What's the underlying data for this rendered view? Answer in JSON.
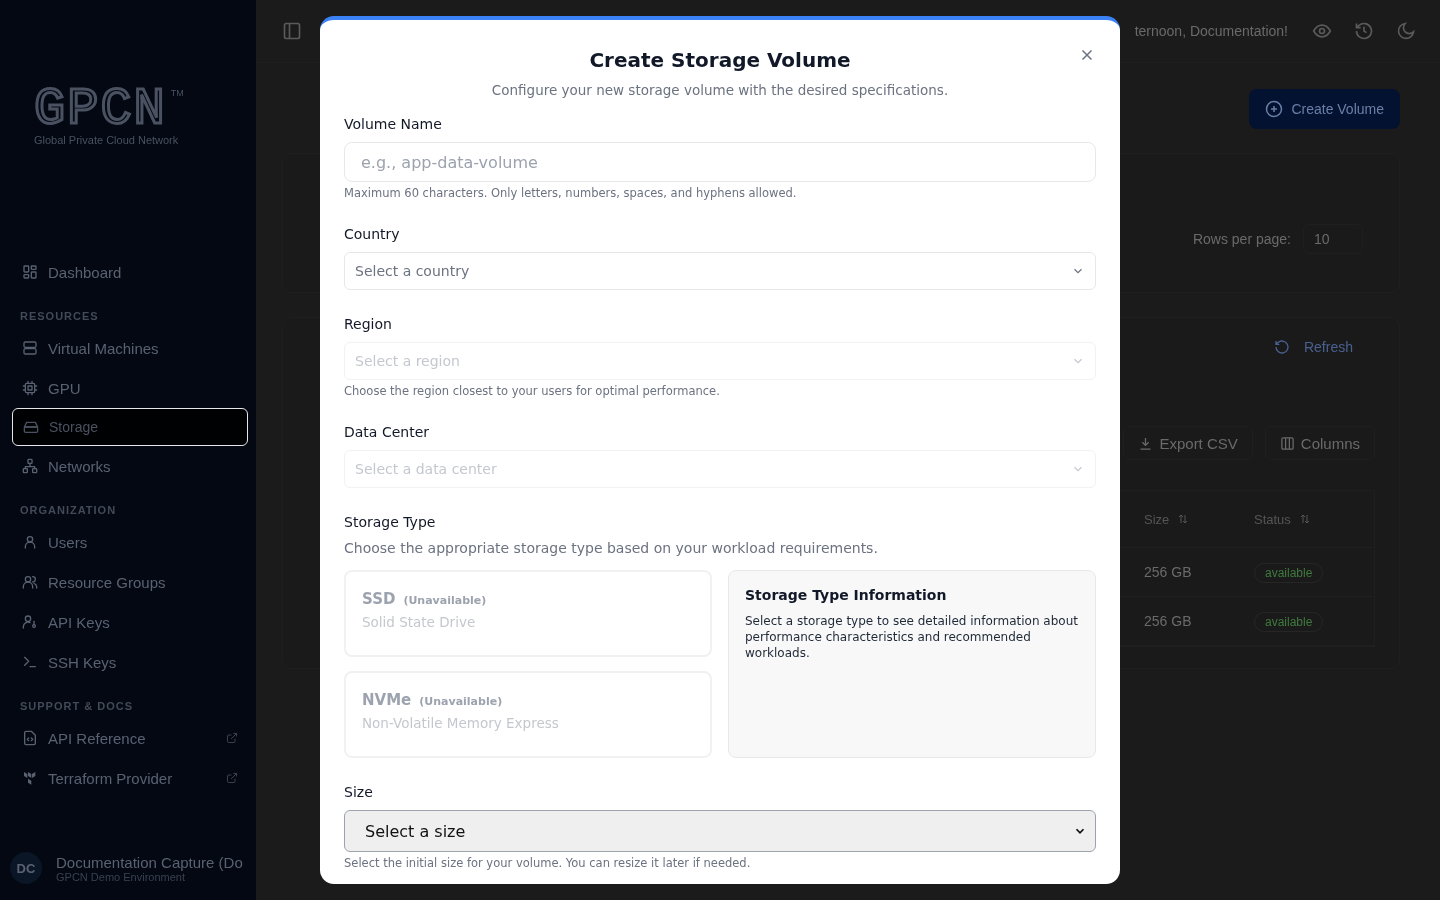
{
  "sidebar": {
    "logo": {
      "mark": "GPCN",
      "trademark": "TM",
      "tagline": "Global Private Cloud Network"
    },
    "sections": [
      {
        "items": [
          {
            "label": "Dashboard",
            "selected": false,
            "external": false
          }
        ]
      },
      {
        "heading": "RESOURCES",
        "items": [
          {
            "label": "Virtual Machines",
            "selected": false,
            "external": false
          },
          {
            "label": "GPU",
            "selected": false,
            "external": false
          },
          {
            "label": "Storage",
            "selected": true,
            "external": false
          },
          {
            "label": "Networks",
            "selected": false,
            "external": false
          }
        ]
      },
      {
        "heading": "ORGANIZATION",
        "items": [
          {
            "label": "Users",
            "selected": false,
            "external": false
          },
          {
            "label": "Resource Groups",
            "selected": false,
            "external": false
          },
          {
            "label": "API Keys",
            "selected": false,
            "external": false
          },
          {
            "label": "SSH Keys",
            "selected": false,
            "external": false
          }
        ]
      },
      {
        "heading": "SUPPORT & DOCS",
        "items": [
          {
            "label": "API Reference",
            "selected": false,
            "external": true
          },
          {
            "label": "Terraform Provider",
            "selected": false,
            "external": true
          }
        ]
      }
    ],
    "user": {
      "initials": "DC",
      "name": "Documentation Capture (Do",
      "org": "GPCN Demo Environment"
    }
  },
  "header": {
    "greeting": "ternoon, Documentation!"
  },
  "page": {
    "create_button": "Create Volume",
    "rows_per_page_label": "Rows per page:",
    "rows_per_page": "10",
    "refresh": "Refresh",
    "export": "Export CSV",
    "columns": "Columns",
    "table": {
      "columns": [
        "Size",
        "Status"
      ],
      "rows": [
        {
          "size": "256 GB",
          "status": "available"
        },
        {
          "size": "256 GB",
          "status": "available"
        }
      ]
    }
  },
  "dialog": {
    "title": "Create Storage Volume",
    "subtitle": "Configure your new storage volume with the desired specifications.",
    "name_field": {
      "label": "Volume Name",
      "placeholder": "e.g., app-data-volume",
      "help": "Maximum 60 characters. Only letters, numbers, spaces, and hyphens allowed."
    },
    "selects": [
      {
        "label": "Country",
        "placeholder": "Select a country",
        "disabled": false
      },
      {
        "label": "Region",
        "placeholder": "Select a region",
        "disabled": true,
        "help": "Choose the region closest to your users for optimal performance."
      },
      {
        "label": "Data Center",
        "placeholder": "Select a data center",
        "disabled": true
      }
    ],
    "storage_type": {
      "label": "Storage Type",
      "help": "Choose the appropriate storage type based on your workload requirements.",
      "options": [
        {
          "name": "SSD",
          "note": "(Unavailable)",
          "description": "Solid State Drive",
          "disabled": true
        },
        {
          "name": "NVMe",
          "note": "(Unavailable)",
          "description": "Non-Volatile Memory Express",
          "disabled": true
        }
      ],
      "info": {
        "title": "Storage Type Information",
        "text": "Select a storage type to see detailed information about performance characteristics and recommended workloads."
      }
    },
    "size": {
      "label": "Size",
      "value": "Select a size",
      "help": "Select the initial size for your volume. You can resize it later if needed."
    }
  }
}
